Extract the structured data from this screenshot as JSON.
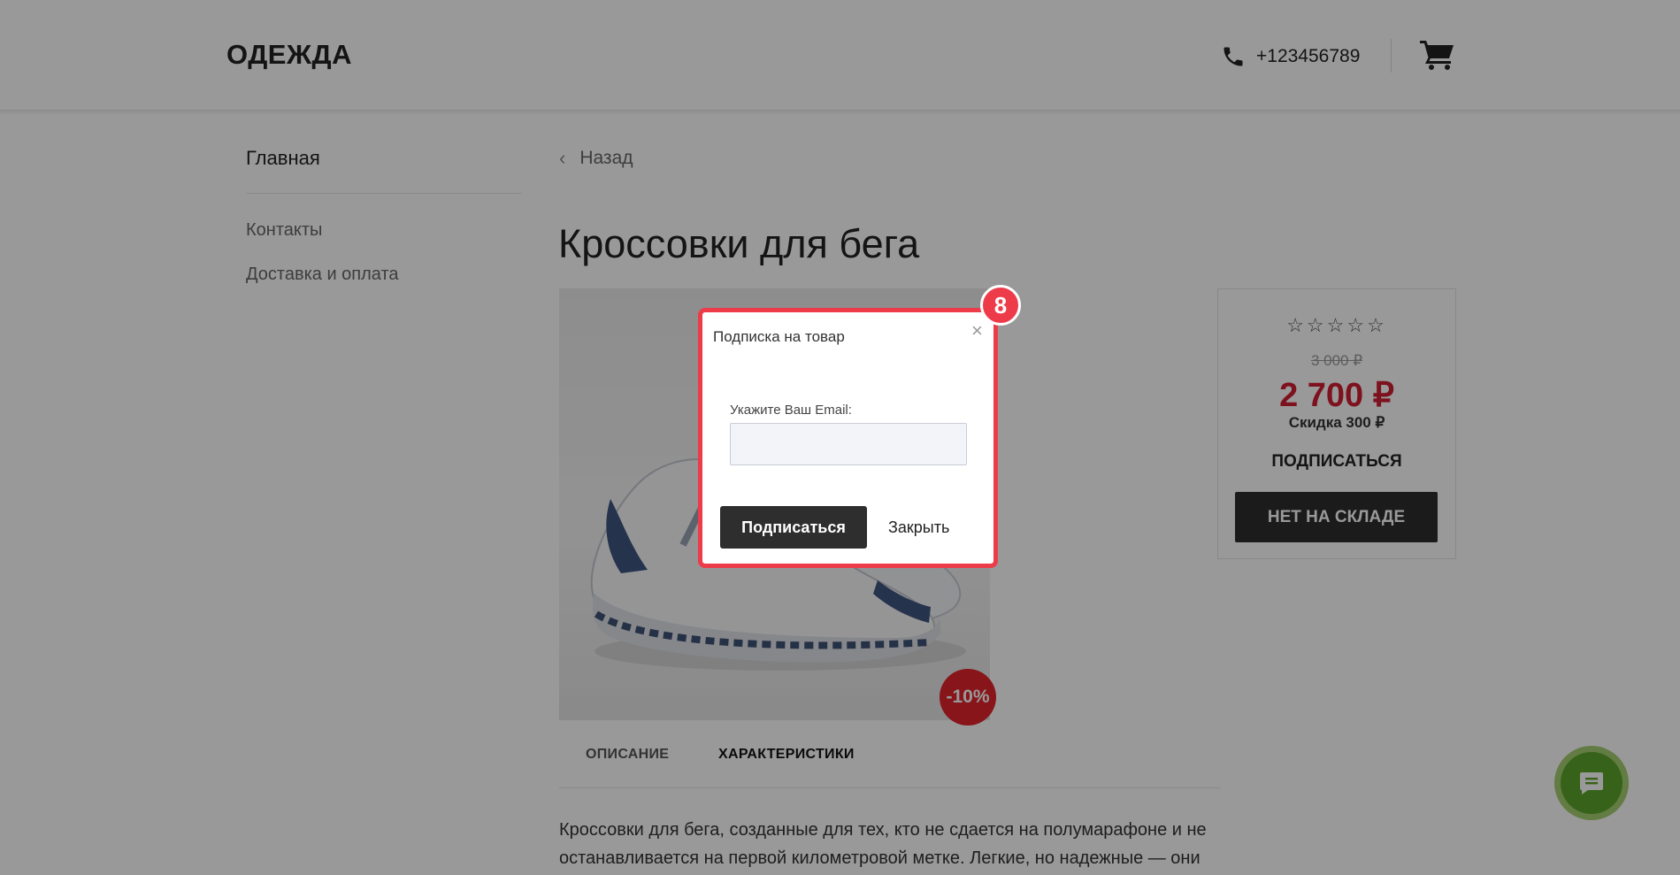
{
  "header": {
    "logo": "ОДЕЖДА",
    "phone": "+123456789",
    "phone_icon": "phone-icon",
    "cart_icon": "cart-icon"
  },
  "sidebar": {
    "items": [
      {
        "label": "Главная",
        "active": true
      },
      {
        "label": "Контакты",
        "active": false
      },
      {
        "label": "Доставка и оплата",
        "active": false
      }
    ]
  },
  "breadcrumb": {
    "back_label": "Назад"
  },
  "product": {
    "title": "Кроссовки для бега",
    "discount_badge": "-10%",
    "rating": {
      "value": 0,
      "max": 5,
      "stars": "☆☆☆☆☆"
    },
    "old_price": "3 000 ₽",
    "new_price": "2 700 ₽",
    "discount_text": "Скидка 300 ₽",
    "subscribe_label": "ПОДПИСАТЬСЯ",
    "stock_button_label": "НЕТ НА СКЛАДЕ",
    "description": "Кроссовки для бега, созданные для тех, кто не сдается на полумарафоне и не останавливается на первой километровой метке. Легкие, но надежные — они"
  },
  "tabs": [
    {
      "label": "ОПИСАНИЕ",
      "active": false
    },
    {
      "label": "ХАРАКТЕРИСТИКИ",
      "active": true
    }
  ],
  "modal": {
    "title": "Подписка на товар",
    "close_glyph": "×",
    "email_label": "Укажите Ваш Email:",
    "email_value": "",
    "email_placeholder": "",
    "subscribe_button": "Подписаться",
    "close_button": "Закрыть",
    "step_badge": "8"
  },
  "colors": {
    "accent_red": "#ee3b4a",
    "price_red": "#d01f32",
    "dark_button": "#2e2e2e",
    "chat_green": "#5aa52a"
  },
  "chat_widget": {
    "icon": "chat-icon"
  }
}
